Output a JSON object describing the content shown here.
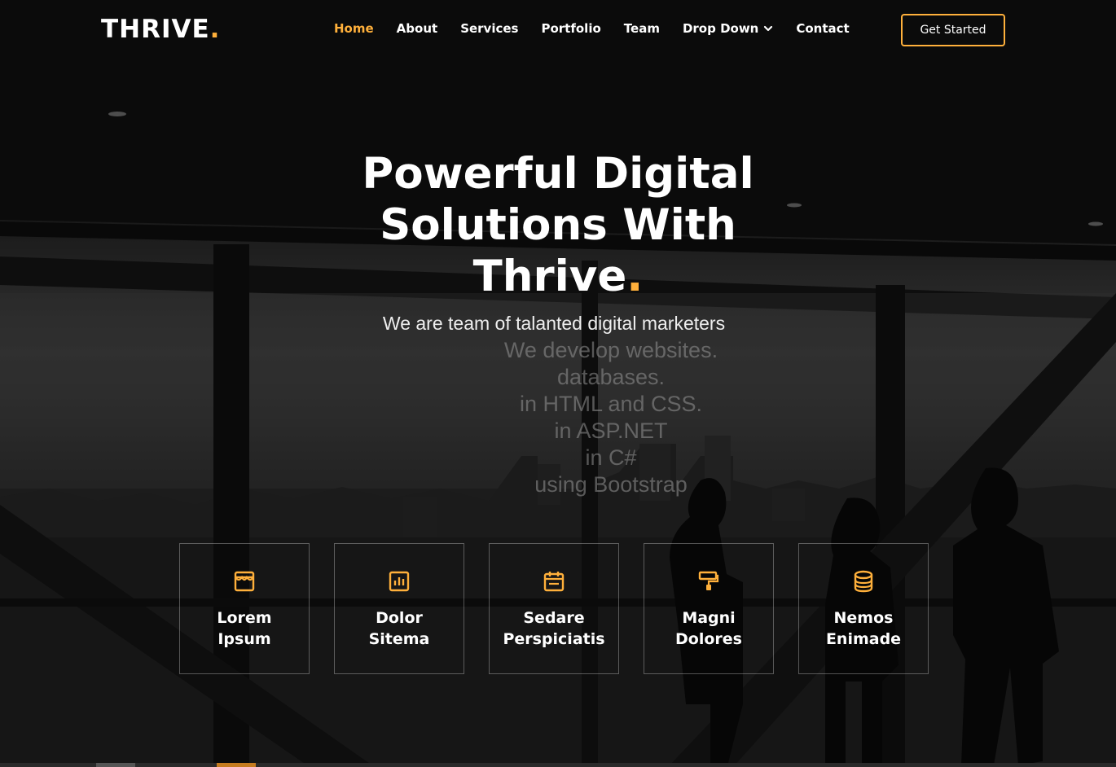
{
  "brand": {
    "name": "THRIVE",
    "dot": ".",
    "accent_color": "#ffb03b"
  },
  "nav": {
    "items": [
      {
        "label": "Home",
        "active": true
      },
      {
        "label": "About"
      },
      {
        "label": "Services"
      },
      {
        "label": "Portfolio"
      },
      {
        "label": "Team"
      },
      {
        "label": "Drop Down",
        "icon": "chevron-down-icon"
      },
      {
        "label": "Contact"
      }
    ],
    "cta": "Get Started"
  },
  "hero": {
    "title_line1": "Powerful Digital",
    "title_line2": "Solutions With",
    "title_line3": "Thrive",
    "title_dot": ".",
    "subtitle": "We are team of talanted digital marketers",
    "typed_lines": [
      "We develop websites.",
      "databases.",
      "in HTML and CSS.",
      "in ASP.NET",
      "in C#",
      "using Bootstrap"
    ]
  },
  "features": [
    {
      "line1": "Lorem",
      "line2": "Ipsum",
      "icon": "store-icon"
    },
    {
      "line1": "Dolor",
      "line2": "Sitema",
      "icon": "bar-chart-icon"
    },
    {
      "line1": "Sedare",
      "line2": "Perspiciatis",
      "icon": "calendar-icon"
    },
    {
      "line1": "Magni",
      "line2": "Dolores",
      "icon": "paint-roller-icon"
    },
    {
      "line1": "Nemos",
      "line2": "Enimade",
      "icon": "database-icon"
    }
  ]
}
